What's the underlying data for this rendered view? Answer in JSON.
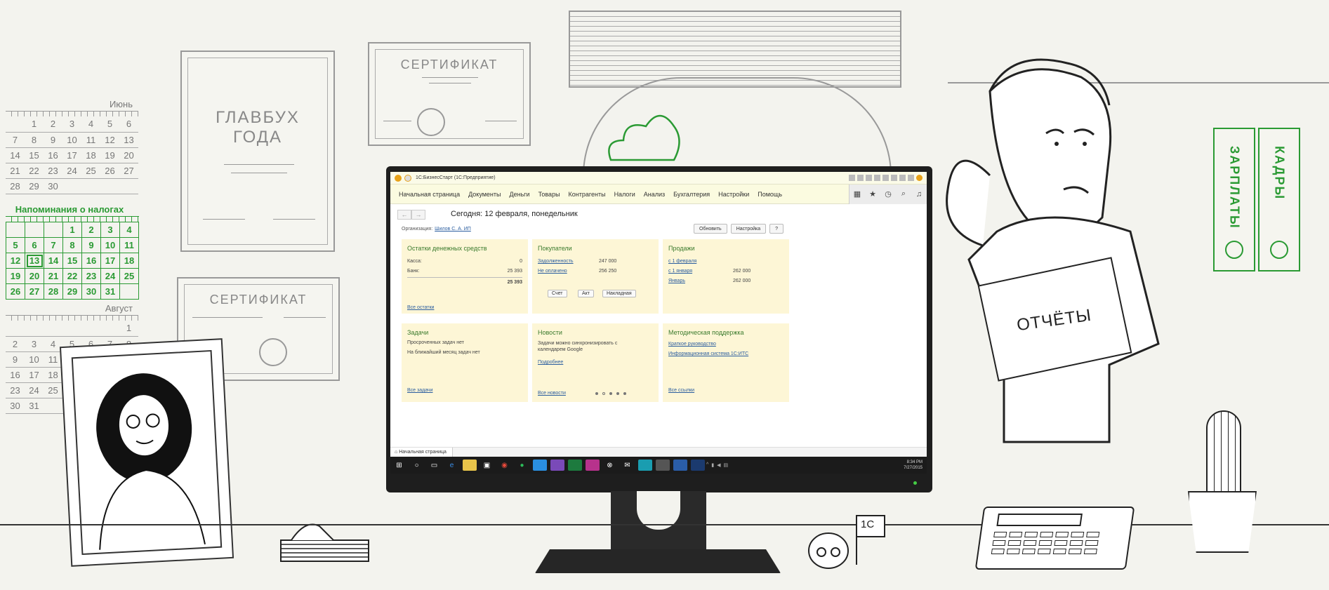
{
  "wall": {
    "calendar_june": {
      "title": "Июнь",
      "rows": [
        [
          "",
          "1",
          "2",
          "3",
          "4",
          "5",
          "6"
        ],
        [
          "7",
          "8",
          "9",
          "10",
          "11",
          "12",
          "13"
        ],
        [
          "14",
          "15",
          "16",
          "17",
          "18",
          "19",
          "20"
        ],
        [
          "21",
          "22",
          "23",
          "24",
          "25",
          "26",
          "27"
        ],
        [
          "28",
          "29",
          "30",
          "",
          "",
          "",
          ""
        ]
      ]
    },
    "calendar_tax": {
      "title": "Напоминания о налогах",
      "rows": [
        [
          "",
          "",
          "",
          "1",
          "2",
          "3",
          "4"
        ],
        [
          "5",
          "6",
          "7",
          "8",
          "9",
          "10",
          "11"
        ],
        [
          "12",
          "13",
          "14",
          "15",
          "16",
          "17",
          "18"
        ],
        [
          "19",
          "20",
          "21",
          "22",
          "23",
          "24",
          "25"
        ],
        [
          "26",
          "27",
          "28",
          "29",
          "30",
          "31",
          ""
        ]
      ]
    },
    "calendar_august": {
      "title": "Август",
      "rows": [
        [
          "",
          "",
          "",
          "",
          "",
          "",
          "1"
        ],
        [
          "2",
          "3",
          "4",
          "5",
          "6",
          "7",
          "8"
        ],
        [
          "9",
          "10",
          "11",
          "",
          "",
          "",
          ""
        ],
        [
          "16",
          "17",
          "18",
          "",
          "",
          "",
          ""
        ],
        [
          "23",
          "24",
          "25",
          "",
          "",
          "",
          ""
        ],
        [
          "30",
          "31",
          "",
          "",
          "",
          "",
          ""
        ]
      ]
    },
    "award_title": "ГЛАВБУХ ГОДА",
    "certificate_1": "СЕРТИФИКАТ",
    "certificate_2": "СЕРТИФИКАТ",
    "binder_1": "ЗАРПЛАТЫ",
    "binder_2": "КАДРЫ",
    "folder_label": "ОТЧЁТЫ",
    "flag_label": "1С",
    "accent_green": "#2a9a33"
  },
  "app": {
    "window_title": "1С:БизнесСтарт (1С:Предприятие)",
    "menu": [
      "Начальная страница",
      "Документы",
      "Деньги",
      "Товары",
      "Контрагенты",
      "Налоги",
      "Анализ",
      "Бухгалтерия",
      "Настройки",
      "Помощь"
    ],
    "page_title": "Сегодня: 12 февраля, понедельник",
    "org_label": "Организация:",
    "org_value": "Шилов С. А. ИП",
    "refresh_btn": "Обновить",
    "settings_btn": "Настройка",
    "help_btn": "?",
    "cash": {
      "title": "Остатки денежных средств",
      "kassa_label": "Касса:",
      "kassa_value": "0",
      "bank_label": "Банк:",
      "bank_value": "25 393",
      "total_value": "25 393",
      "link": "Все остатки"
    },
    "buyers": {
      "title": "Покупатели",
      "debt_label": "Задолженность",
      "debt_value": "247 000",
      "unpaid_label": "Не оплачено",
      "unpaid_value": "256 250",
      "btn_invoice": "Счет",
      "btn_act": "Акт",
      "btn_waybill": "Накладная"
    },
    "sales": {
      "title": "Продажи",
      "row1_label": "с 1 февраля",
      "row1_value": "",
      "row2_label": "с 1 января",
      "row2_value": "262 000",
      "row3_label": "Январь",
      "row3_value": "262 000"
    },
    "tasks": {
      "title": "Задачи",
      "line1": "Просроченных задач нет",
      "line2": "На ближайший месяц задач нет",
      "link": "Все задачи"
    },
    "news": {
      "title": "Новости",
      "text": "Задачи можно синхронизировать с календарем Google",
      "more": "Подробнее",
      "link": "Все новости"
    },
    "support": {
      "title": "Методическая поддержка",
      "link1": "Краткое руководство",
      "link2": "Информационная система 1С:ИТС",
      "link": "Все ссылки"
    },
    "status_tab": "Начальная страница",
    "clock_time": "8:34 PM",
    "clock_date": "7/27/2015"
  }
}
